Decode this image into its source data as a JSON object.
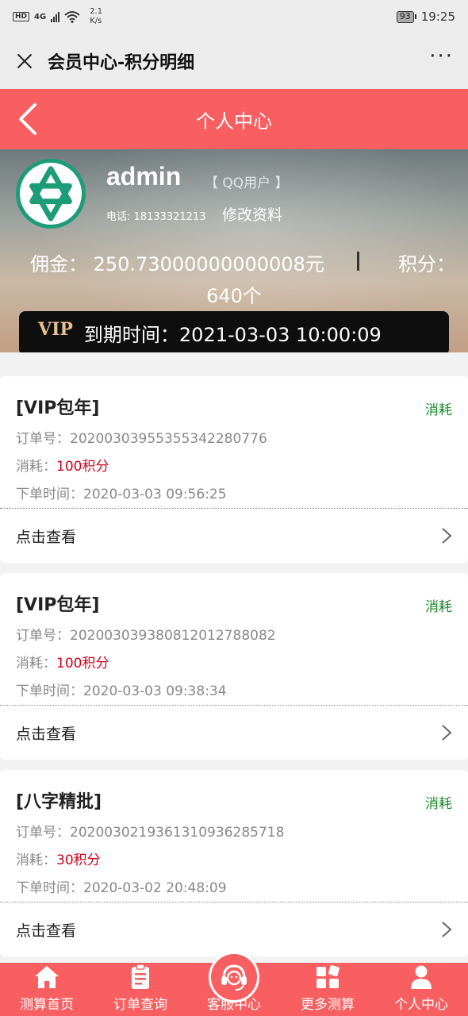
{
  "status_bar": {
    "hd": "HD",
    "network": "4G",
    "speed_top": "2.1",
    "speed_bottom": "K/s",
    "battery": "93",
    "time": "19:25"
  },
  "window": {
    "title": "会员中心-积分明细",
    "more": "···"
  },
  "header": {
    "title": "个人中心"
  },
  "profile": {
    "username": "admin",
    "user_type": "【 QQ用户 】",
    "phone": "电话: 18133321213",
    "edit_label": "修改资料",
    "commission": "佣金：  250.73000000000008元",
    "points_label": "积分：",
    "points_value": "640个",
    "vip_label": "VIP",
    "vip_expiry": "到期时间：2021-03-03 10:00:09"
  },
  "orders": [
    {
      "product": "[VIP包年]",
      "status": "消耗",
      "order_no_label": "订单号：",
      "order_no": "20200303955355342280776",
      "cost_label": "消耗：",
      "cost": "100积分",
      "time_label": "下单时间：",
      "time": "2020-03-03 09:56:25",
      "view": "点击查看"
    },
    {
      "product": "[VIP包年]",
      "status": "消耗",
      "order_no_label": "订单号：",
      "order_no": "20200303938081201278808 2",
      "cost_label": "消耗：",
      "cost": "100积分",
      "time_label": "下单时间：",
      "time": "2020-03-03 09:38:34",
      "view": "点击查看"
    },
    {
      "product": "[八字精批]",
      "status": "消耗",
      "order_no_label": "订单号：",
      "order_no": "20200302193613109362857 18",
      "cost_label": "消耗：",
      "cost": "30积分",
      "time_label": "下单时间：",
      "time": "2020-03-02 20:48:09",
      "view": "点击查看"
    }
  ],
  "nav": [
    {
      "label": "测算首页",
      "icon": "home-icon"
    },
    {
      "label": "订单查询",
      "icon": "clipboard-icon"
    },
    {
      "label": "客服中心",
      "icon": "headset-icon"
    },
    {
      "label": "更多测算",
      "icon": "grid-icon"
    },
    {
      "label": "个人中心",
      "icon": "user-icon"
    }
  ],
  "colors": {
    "accent": "#f95f60",
    "consume_status": "#1a8a2a",
    "cost_red": "#d0021b",
    "vip_gold": "#e3c08e"
  }
}
